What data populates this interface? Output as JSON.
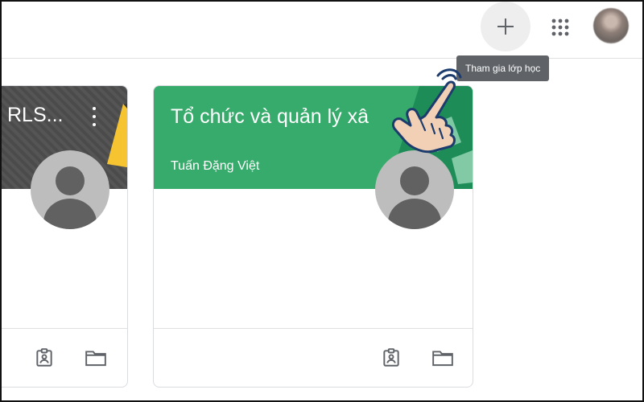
{
  "header": {
    "add_button_icon": "plus-icon",
    "apps_button_icon": "apps-grid-icon",
    "account_avatar": "account-avatar"
  },
  "tooltip": {
    "text": "Tham gia lớp học"
  },
  "classes": [
    {
      "title": "RLS...",
      "header_color": "#4e4e4e",
      "menu_icon": "more-vert-icon"
    },
    {
      "title": "Tổ chức và quản lý xâ",
      "teacher": "Tuấn Đặng Việt",
      "header_color": "#36ab6b"
    }
  ],
  "card_footer_icons": [
    "assignment-icon",
    "folder-icon"
  ],
  "overlay": {
    "pointer": "hand-pointer-icon"
  },
  "colors": {
    "accent_green": "#36ab6b",
    "tooltip_bg": "#5f6368",
    "avatar_gray": "#616161"
  }
}
